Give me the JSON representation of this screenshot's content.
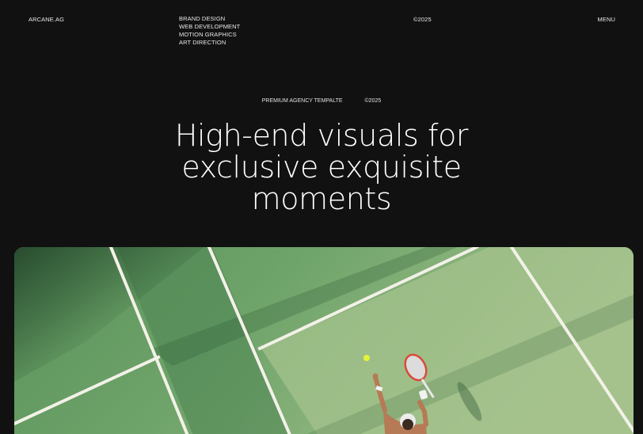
{
  "header": {
    "logo": "ARCANE.AG",
    "services": [
      "BRAND DESIGN",
      "WEB DEVELOPMENT",
      "MOTION GRAPHICS",
      "ART DIRECTION"
    ],
    "year": "©2025",
    "menu_label": "MENU"
  },
  "hero": {
    "tag": "PREMIUM AGENCY TEMPALTE",
    "year": "©2025",
    "headline_lines": [
      "High-end visuals for",
      "exclusive exquisite",
      "moments"
    ]
  },
  "image": {
    "subject": "tennis-court-aerial-photo",
    "colors": {
      "court_light": "#a3c18b",
      "court_mid": "#679e65",
      "court_dark": "#3d6c45",
      "line": "#f3f1e8"
    }
  }
}
